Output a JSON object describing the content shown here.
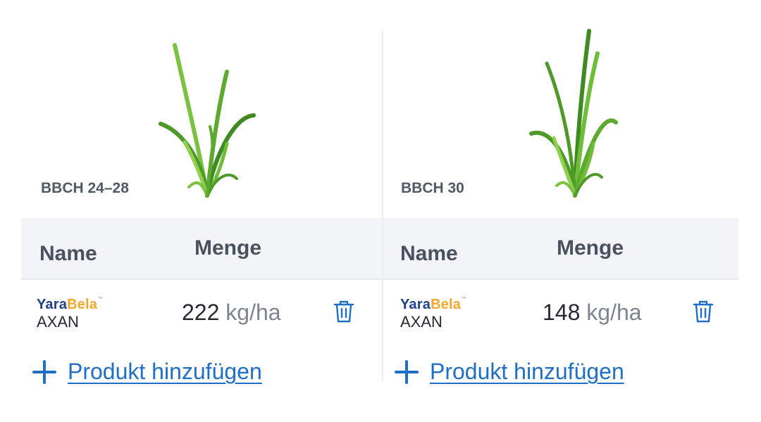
{
  "panels": [
    {
      "stage": "BBCH 24–28",
      "col_name": "Name",
      "col_amount": "Menge",
      "product": {
        "brand_1": "Yara",
        "brand_2": "Bela",
        "tm": "™",
        "name": "AXAN",
        "amount": "222",
        "unit": "kg/ha"
      },
      "add_label": "Produkt hinzufügen"
    },
    {
      "stage": "BBCH 30",
      "col_name": "Name",
      "col_amount": "Menge",
      "product": {
        "brand_1": "Yara",
        "brand_2": "Bela",
        "tm": "™",
        "name": "AXAN",
        "amount": "148",
        "unit": "kg/ha"
      },
      "add_label": "Produkt hinzufügen"
    }
  ],
  "icons": {
    "delete": "trash-icon",
    "add": "plus-icon",
    "plant": "wheat-plant-icon"
  },
  "colors": {
    "link": "#1f6fc5",
    "brand_blue": "#1f3f8f",
    "brand_orange": "#f1a82c",
    "header_bg": "#f2f4f7"
  }
}
